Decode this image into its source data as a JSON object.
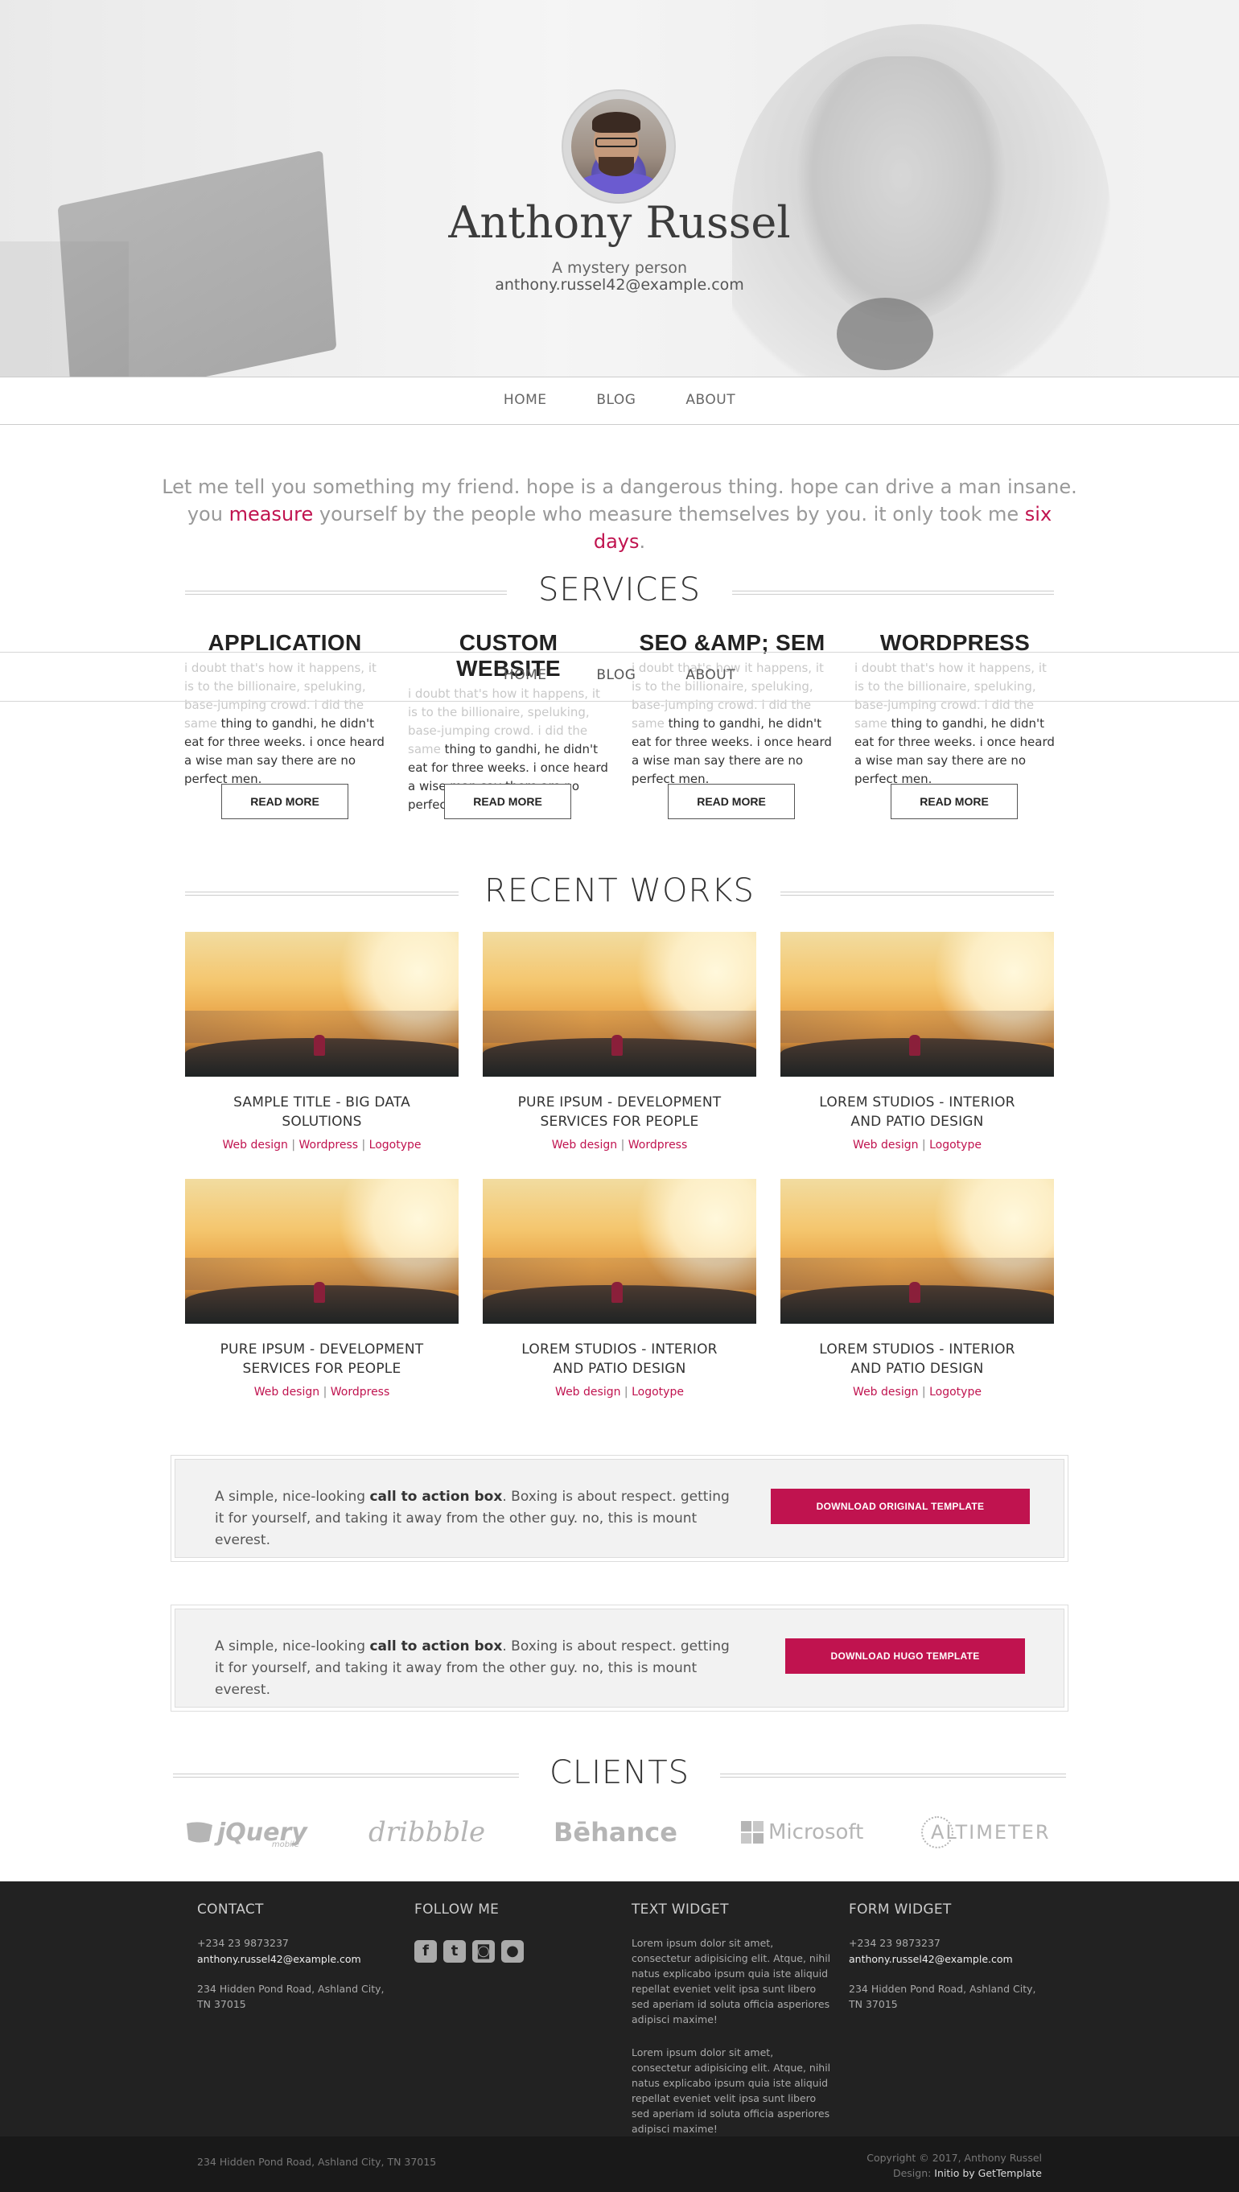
{
  "hero": {
    "name": "Anthony Russel",
    "tagline": "A mystery person",
    "email": "anthony.russel42@example.com"
  },
  "nav": {
    "items": [
      "HOME",
      "BLOG",
      "ABOUT"
    ]
  },
  "lead": {
    "part1": "Let me tell you something my friend. hope is a dangerous thing. hope can drive a man insane.",
    "part2_pre": "you ",
    "hl1": "measure",
    "part2_mid": " yourself by the people who measure themselves by you. it only took me ",
    "hl2": "six days",
    "part2_end": "."
  },
  "services": {
    "title": "SERVICES",
    "items": [
      {
        "title": "APPLICATION",
        "faint": "i doubt that's how it happens, it is to the billionaire, speluking, base-jumping crowd. i did the same",
        "text": "thing to gandhi, he didn't eat for three weeks. i once heard a wise man say there are no perfect men.",
        "button": "READ MORE"
      },
      {
        "title": "CUSTOM WEBSITE",
        "faint": "i doubt that's how it happens, it is to the billionaire, speluking, base-jumping crowd. i did the same",
        "text": "thing to gandhi, he didn't eat for three weeks. i once heard a wise man say there are no perfect men.",
        "button": "READ MORE"
      },
      {
        "title": "SEO &AMP; SEM",
        "faint": "i doubt that's how it happens, it is to the billionaire, speluking, base-jumping crowd. i did the same",
        "text": "thing to gandhi, he didn't eat for three weeks. i once heard a wise man say there are no perfect men.",
        "button": "READ MORE"
      },
      {
        "title": "WORDPRESS",
        "faint": "i doubt that's how it happens, it is to the billionaire, speluking, base-jumping crowd. i did the same",
        "text": "thing to gandhi, he didn't eat for three weeks. i once heard a wise man say there are no perfect men.",
        "button": "READ MORE"
      }
    ]
  },
  "works": {
    "title": "RECENT WORKS",
    "items": [
      {
        "title": "SAMPLE TITLE - BIG DATA SOLUTIONS",
        "tags": [
          "Web design",
          "Wordpress",
          "Logotype"
        ]
      },
      {
        "title": "PURE IPSUM - DEVELOPMENT SERVICES FOR PEOPLE",
        "tags": [
          "Web design",
          "Wordpress"
        ]
      },
      {
        "title": "LOREM STUDIOS - INTERIOR AND PATIO DESIGN",
        "tags": [
          "Web design",
          "Logotype"
        ]
      },
      {
        "title": "PURE IPSUM - DEVELOPMENT SERVICES FOR PEOPLE",
        "tags": [
          "Web design",
          "Wordpress"
        ]
      },
      {
        "title": "LOREM STUDIOS - INTERIOR AND PATIO DESIGN",
        "tags": [
          "Web design",
          "Logotype"
        ]
      },
      {
        "title": "LOREM STUDIOS - INTERIOR AND PATIO DESIGN",
        "tags": [
          "Web design",
          "Logotype"
        ]
      }
    ]
  },
  "cta": [
    {
      "pre": "A simple, nice-looking ",
      "bold": "call to action box",
      "post": ". Boxing is about respect. getting it for yourself, and taking it away from the other guy. no, this is mount everest.",
      "button": "DOWNLOAD ORIGINAL TEMPLATE"
    },
    {
      "pre": "A simple, nice-looking ",
      "bold": "call to action box",
      "post": ". Boxing is about respect. getting it for yourself, and taking it away from the other guy. no, this is mount everest.",
      "button": "DOWNLOAD HUGO TEMPLATE"
    }
  ],
  "clients": {
    "title": "CLIENTS",
    "logos": [
      "jQuery",
      "mobile",
      "dribbble",
      "Bēhance",
      "Microsoft",
      "ALTIMETER"
    ]
  },
  "footer": {
    "contact": {
      "title": "CONTACT",
      "phone": "+234 23 9873237",
      "email": "anthony.russel42@example.com",
      "address": "234 Hidden Pond Road, Ashland City, TN 37015"
    },
    "follow": {
      "title": "FOLLOW ME",
      "icons": [
        "facebook-icon",
        "twitter-icon",
        "instagram-icon",
        "github-icon"
      ]
    },
    "text_widget": {
      "title": "TEXT WIDGET",
      "p1": "Lorem ipsum dolor sit amet, consectetur adipisicing elit. Atque, nihil natus explicabo ipsum quia iste aliquid repellat eveniet velit ipsa sunt libero sed aperiam id soluta officia asperiores adipisci maxime!",
      "p2": "Lorem ipsum dolor sit amet, consectetur adipisicing elit. Atque, nihil natus explicabo ipsum quia iste aliquid repellat eveniet velit ipsa sunt libero sed aperiam id soluta officia asperiores adipisci maxime!"
    },
    "form_widget": {
      "title": "FORM WIDGET",
      "phone": "+234 23 9873237",
      "email": "anthony.russel42@example.com",
      "address": "234 Hidden Pond Road, Ashland City, TN 37015"
    },
    "bottom_left": "234 Hidden Pond Road, Ashland City, TN 37015",
    "copyright": "Copyright © 2017, Anthony Russel",
    "design_label": "Design: ",
    "design_credit": "Initio by GetTemplate"
  },
  "colors": {
    "accent": "#c0134f",
    "footer_bg": "#222222"
  }
}
